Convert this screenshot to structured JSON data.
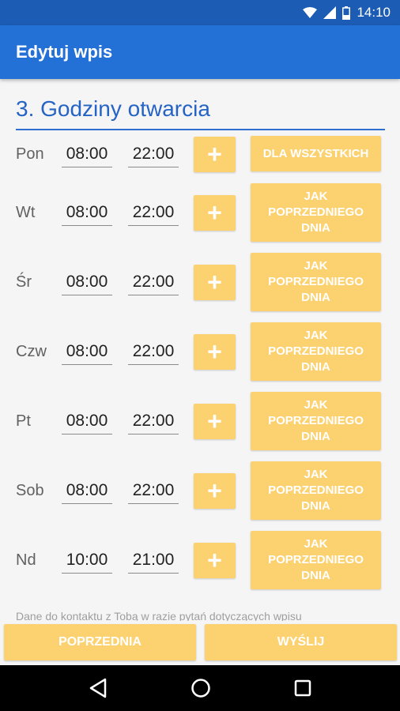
{
  "status_bar": {
    "time": "14:10"
  },
  "app_bar": {
    "title": "Edytuj wpis"
  },
  "section": {
    "title": "3. Godziny otwarcia"
  },
  "rows": [
    {
      "day": "Pon",
      "open": "08:00",
      "close": "22:00",
      "add": "+",
      "action": "DLA WSZYSTKICH"
    },
    {
      "day": "Wt",
      "open": "08:00",
      "close": "22:00",
      "add": "+",
      "action": "JAK POPRZEDNIEGO DNIA"
    },
    {
      "day": "Śr",
      "open": "08:00",
      "close": "22:00",
      "add": "+",
      "action": "JAK POPRZEDNIEGO DNIA"
    },
    {
      "day": "Czw",
      "open": "08:00",
      "close": "22:00",
      "add": "+",
      "action": "JAK POPRZEDNIEGO DNIA"
    },
    {
      "day": "Pt",
      "open": "08:00",
      "close": "22:00",
      "add": "+",
      "action": "JAK POPRZEDNIEGO DNIA"
    },
    {
      "day": "Sob",
      "open": "08:00",
      "close": "22:00",
      "add": "+",
      "action": "JAK POPRZEDNIEGO DNIA"
    },
    {
      "day": "Nd",
      "open": "10:00",
      "close": "21:00",
      "add": "+",
      "action": "JAK POPRZEDNIEGO DNIA"
    }
  ],
  "footnote": "Dane do kontaktu z Tobą w razie pytań dotyczących wpisu",
  "bottom_buttons": {
    "previous": "POPRZEDNIA",
    "send": "WYŚLIJ"
  },
  "colors": {
    "primary": "#2370d6",
    "status_bar": "#1c5cb4",
    "accent": "#fcd271",
    "title": "#2563c4"
  },
  "icons": {
    "status": [
      "wifi-icon",
      "signal-icon",
      "battery-icon"
    ],
    "nav": [
      "back-icon",
      "home-icon",
      "recents-icon"
    ]
  }
}
